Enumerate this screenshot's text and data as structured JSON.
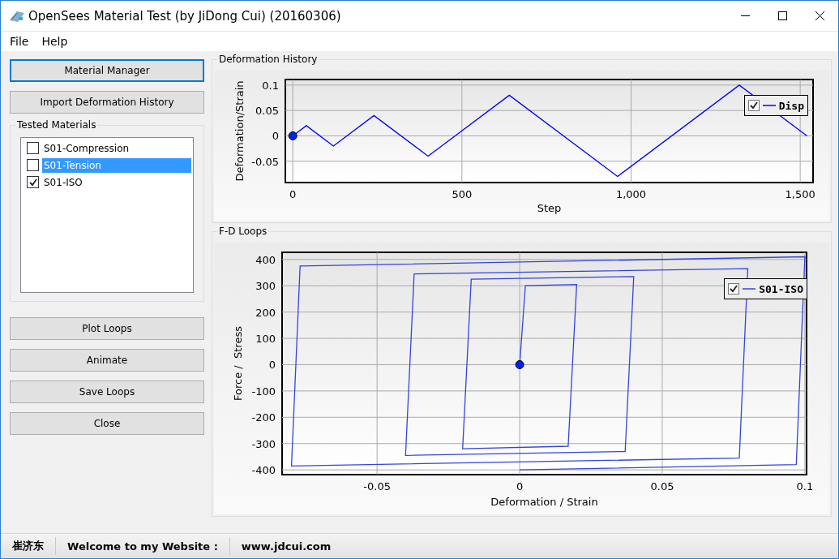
{
  "window": {
    "title": "OpenSees Material Test (by JiDong Cui) (20160306)"
  },
  "menu": [
    {
      "label": "File"
    },
    {
      "label": "Help"
    }
  ],
  "left_panel": {
    "buttons_top": [
      {
        "label": "Material Manager",
        "focused": true
      },
      {
        "label": "Import Deformation History",
        "focused": false
      }
    ],
    "tested_materials": {
      "title": "Tested Materials",
      "items": [
        {
          "label": "S01-Compression",
          "checked": false,
          "selected": false
        },
        {
          "label": "S01-Tension",
          "checked": false,
          "selected": true
        },
        {
          "label": "S01-ISO",
          "checked": true,
          "selected": false
        }
      ]
    },
    "buttons_bottom": [
      {
        "label": "Plot Loops",
        "focused": false
      },
      {
        "label": "Animate",
        "focused": false
      },
      {
        "label": "Save Loops",
        "focused": false
      },
      {
        "label": "Close",
        "focused": false
      }
    ]
  },
  "deformation_history": {
    "title": "Deformation History",
    "legend": {
      "checked": true
    },
    "chart_data": {
      "type": "line",
      "xlabel": "Step",
      "ylabel": "Deformation/Strain",
      "x": [
        0,
        40,
        120,
        240,
        400,
        640,
        960,
        1320,
        1520
      ],
      "series": [
        {
          "name": "Disp",
          "color": "#0000ff",
          "values": [
            0,
            0.02,
            -0.02,
            0.04,
            -0.04,
            0.08,
            -0.08,
            0.1,
            0
          ]
        }
      ],
      "xlim": [
        -22,
        1538
      ],
      "ylim": [
        -0.092,
        0.111
      ],
      "xticks": [
        0,
        500,
        {
          "value": 1000,
          "label": "1,000"
        },
        {
          "value": 1500,
          "label": "1,500"
        }
      ],
      "yticks": [
        -0.05,
        0,
        0.05,
        0.1
      ],
      "grid": true
    }
  },
  "fd_loops": {
    "title": "F-D Loops",
    "legend": {
      "checked": true
    },
    "chart_data": {
      "type": "line",
      "xlabel": "Deformation / Strain",
      "ylabel": "Force /  Stress",
      "x": [
        0,
        0.002,
        0.02,
        0.017,
        -0.02,
        -0.017,
        0.04,
        0.037,
        -0.04,
        -0.037,
        0.08,
        0.077,
        -0.08,
        -0.077,
        0.1,
        0.097,
        0
      ],
      "series": [
        {
          "name": "S01-ISO",
          "color": "#3344dd",
          "values": [
            0,
            300,
            305,
            -310,
            -320,
            325,
            335,
            -330,
            -345,
            345,
            365,
            -355,
            -385,
            375,
            410,
            -380,
            -400
          ]
        }
      ],
      "xlim": [
        -0.0833,
        0.1006
      ],
      "ylim": [
        -418,
        427
      ],
      "xticks": [
        -0.05,
        0,
        0.05,
        0.1
      ],
      "yticks": [
        -400,
        -300,
        -200,
        -100,
        0,
        100,
        200,
        300,
        400
      ],
      "grid": true
    }
  },
  "status_bar": [
    {
      "text": "崔济东"
    },
    {
      "text": "Welcome to my Website :"
    },
    {
      "text": "www.jdcui.com"
    }
  ]
}
